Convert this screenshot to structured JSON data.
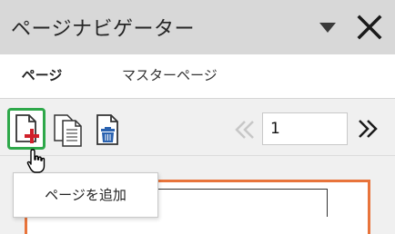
{
  "panel": {
    "title": "ページナビゲーター",
    "dropdown_icon": "triangle-down-icon",
    "close_icon": "close-icon"
  },
  "tabs": [
    {
      "label": "ページ",
      "active": true
    },
    {
      "label": "マスターページ",
      "active": false
    }
  ],
  "toolbar": {
    "add_page_icon": "add-page-icon",
    "duplicate_page_icon": "duplicate-page-icon",
    "delete_page_icon": "delete-page-icon",
    "prev_icon": "double-chevron-left-icon",
    "page_number": "1",
    "next_icon": "double-chevron-right-icon"
  },
  "tooltip": {
    "text": "ページを追加"
  },
  "colors": {
    "titlebar_bg": "#d8d8d8",
    "highlight_border": "#2ea84a",
    "thumbnail_border": "#e8743b",
    "add_cross": "#d0202a",
    "trash_blue": "#2a62b0"
  }
}
